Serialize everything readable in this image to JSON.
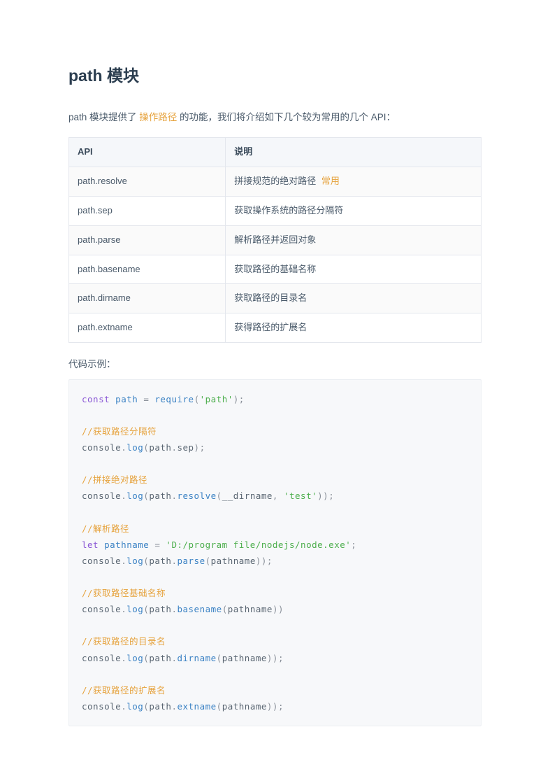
{
  "title": "path 模块",
  "intro": {
    "pre": "path 模块提供了 ",
    "highlight": "操作路径",
    "post": " 的功能，我们将介绍如下几个较为常用的几个 API："
  },
  "table": {
    "headers": {
      "api": "API",
      "desc": "说明"
    },
    "rows": [
      {
        "api": "path.resolve",
        "desc": "拼接规范的绝对路径",
        "badge": "常用"
      },
      {
        "api": "path.sep",
        "desc": "获取操作系统的路径分隔符"
      },
      {
        "api": "path.parse",
        "desc": "解析路径并返回对象"
      },
      {
        "api": "path.basename",
        "desc": "获取路径的基础名称"
      },
      {
        "api": "path.dirname",
        "desc": "获取路径的目录名"
      },
      {
        "api": "path.extname",
        "desc": "获得路径的扩展名"
      }
    ]
  },
  "example_label": "代码示例：",
  "code": {
    "lines": [
      [
        {
          "t": "kw",
          "v": "const"
        },
        {
          "t": "plain",
          "v": " "
        },
        {
          "t": "var",
          "v": "path"
        },
        {
          "t": "plain",
          "v": " "
        },
        {
          "t": "punc",
          "v": "="
        },
        {
          "t": "plain",
          "v": " "
        },
        {
          "t": "fn",
          "v": "require"
        },
        {
          "t": "punc",
          "v": "("
        },
        {
          "t": "str",
          "v": "'path'"
        },
        {
          "t": "punc",
          "v": ");"
        }
      ],
      [],
      [
        {
          "t": "cmt",
          "v": "//获取路径分隔符"
        }
      ],
      [
        {
          "t": "plain",
          "v": "console"
        },
        {
          "t": "punc",
          "v": "."
        },
        {
          "t": "fn",
          "v": "log"
        },
        {
          "t": "punc",
          "v": "("
        },
        {
          "t": "plain",
          "v": "path"
        },
        {
          "t": "punc",
          "v": "."
        },
        {
          "t": "plain",
          "v": "sep"
        },
        {
          "t": "punc",
          "v": ");"
        }
      ],
      [],
      [
        {
          "t": "cmt",
          "v": "//拼接绝对路径"
        }
      ],
      [
        {
          "t": "plain",
          "v": "console"
        },
        {
          "t": "punc",
          "v": "."
        },
        {
          "t": "fn",
          "v": "log"
        },
        {
          "t": "punc",
          "v": "("
        },
        {
          "t": "plain",
          "v": "path"
        },
        {
          "t": "punc",
          "v": "."
        },
        {
          "t": "fn",
          "v": "resolve"
        },
        {
          "t": "punc",
          "v": "("
        },
        {
          "t": "plain",
          "v": "__dirname"
        },
        {
          "t": "punc",
          "v": ", "
        },
        {
          "t": "str",
          "v": "'test'"
        },
        {
          "t": "punc",
          "v": "));"
        }
      ],
      [],
      [
        {
          "t": "cmt",
          "v": "//解析路径"
        }
      ],
      [
        {
          "t": "kw",
          "v": "let"
        },
        {
          "t": "plain",
          "v": " "
        },
        {
          "t": "var",
          "v": "pathname"
        },
        {
          "t": "plain",
          "v": " "
        },
        {
          "t": "punc",
          "v": "="
        },
        {
          "t": "plain",
          "v": " "
        },
        {
          "t": "str",
          "v": "'D:/program file/nodejs/node.exe'"
        },
        {
          "t": "punc",
          "v": ";"
        }
      ],
      [
        {
          "t": "plain",
          "v": "console"
        },
        {
          "t": "punc",
          "v": "."
        },
        {
          "t": "fn",
          "v": "log"
        },
        {
          "t": "punc",
          "v": "("
        },
        {
          "t": "plain",
          "v": "path"
        },
        {
          "t": "punc",
          "v": "."
        },
        {
          "t": "fn",
          "v": "parse"
        },
        {
          "t": "punc",
          "v": "("
        },
        {
          "t": "plain",
          "v": "pathname"
        },
        {
          "t": "punc",
          "v": "));"
        }
      ],
      [],
      [
        {
          "t": "cmt",
          "v": "//获取路径基础名称"
        }
      ],
      [
        {
          "t": "plain",
          "v": "console"
        },
        {
          "t": "punc",
          "v": "."
        },
        {
          "t": "fn",
          "v": "log"
        },
        {
          "t": "punc",
          "v": "("
        },
        {
          "t": "plain",
          "v": "path"
        },
        {
          "t": "punc",
          "v": "."
        },
        {
          "t": "fn",
          "v": "basename"
        },
        {
          "t": "punc",
          "v": "("
        },
        {
          "t": "plain",
          "v": "pathname"
        },
        {
          "t": "punc",
          "v": "))"
        }
      ],
      [],
      [
        {
          "t": "cmt",
          "v": "//获取路径的目录名"
        }
      ],
      [
        {
          "t": "plain",
          "v": "console"
        },
        {
          "t": "punc",
          "v": "."
        },
        {
          "t": "fn",
          "v": "log"
        },
        {
          "t": "punc",
          "v": "("
        },
        {
          "t": "plain",
          "v": "path"
        },
        {
          "t": "punc",
          "v": "."
        },
        {
          "t": "fn",
          "v": "dirname"
        },
        {
          "t": "punc",
          "v": "("
        },
        {
          "t": "plain",
          "v": "pathname"
        },
        {
          "t": "punc",
          "v": "));"
        }
      ],
      [],
      [
        {
          "t": "cmt",
          "v": "//获取路径的扩展名"
        }
      ],
      [
        {
          "t": "plain",
          "v": "console"
        },
        {
          "t": "punc",
          "v": "."
        },
        {
          "t": "fn",
          "v": "log"
        },
        {
          "t": "punc",
          "v": "("
        },
        {
          "t": "plain",
          "v": "path"
        },
        {
          "t": "punc",
          "v": "."
        },
        {
          "t": "fn",
          "v": "extname"
        },
        {
          "t": "punc",
          "v": "("
        },
        {
          "t": "plain",
          "v": "pathname"
        },
        {
          "t": "punc",
          "v": "));"
        }
      ]
    ]
  }
}
